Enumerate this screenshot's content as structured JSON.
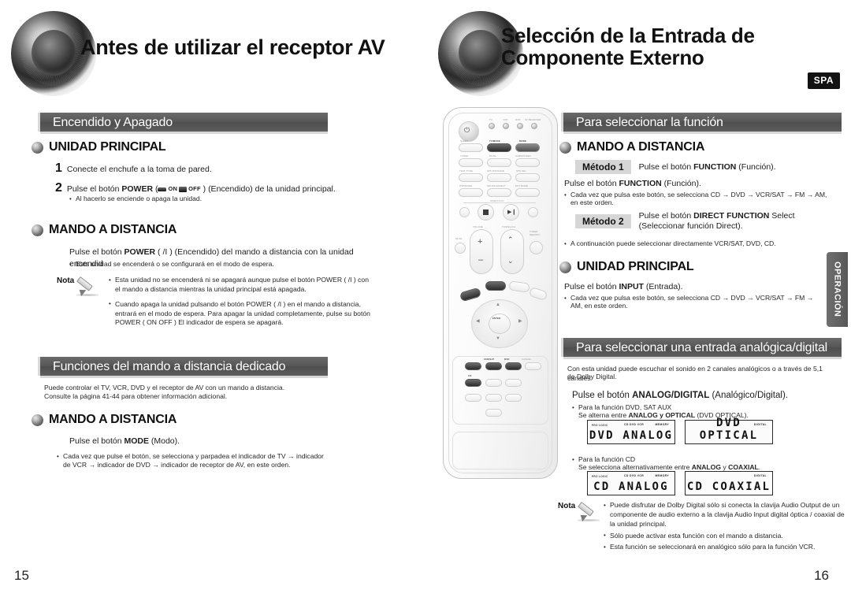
{
  "left_page": {
    "chapter_title": "Antes de utilizar el receptor AV",
    "page_number": "15",
    "sections": [
      {
        "bar_title": "Encendido y Apagado",
        "head1": "UNIDAD PRINCIPAL",
        "step1_num": "1",
        "step1_text": "Conecte el enchufe a la toma de pared.",
        "step2_num": "2",
        "step2_a": "Pulse el botón ",
        "step2_b": "POWER",
        "step2_c": " (",
        "step2_on": "ON",
        "step2_off": "OFF",
        "step2_d": " ) (Encendido) de la unidad principal.",
        "step2_note": "Al hacerlo se enciende o apaga la unidad.",
        "head2": "MANDO A DISTANCIA",
        "rc_line_a": "Pulse el botón ",
        "rc_line_b": "POWER",
        "rc_line_c": " (      /I ) (Encendido) del mando a distancia con la unidad encendid",
        "rc_note": "Esta unidad se encenderá o se configurará en el modo de espera.",
        "nota_label": "Nota",
        "nota_items": [
          "Esta unidad no se encenderá ni se apagará aunque pulse el botón POWER (   /I ) con el mando a distancia mientras la unidad principal está apagada.",
          "Cuando apaga la unidad pulsando el botón POWER (   /I ) en el mando a distancia, entrará en el modo de espera. Para apagar la unidad completamente, pulse su botón POWER (    ON    OFF  ) El indicador de espera se apagará."
        ]
      },
      {
        "bar_title": "Funciones del mando a distancia dedicado",
        "intro_l1": "Puede controlar el TV, VCR, DVD y el receptor de AV con un mando a distancia.",
        "intro_l2": "Consulte la página 41-44 para obtener información adicional.",
        "head1": "MANDO A DISTANCIA",
        "line_a": "Pulse el botón ",
        "line_b": "MODE",
        "line_c": " (Modo).",
        "note_l1": "Cada vez que pulse el botón, se selecciona y parpadea el indicador de TV  → indicador",
        "note_l2": "de VCR → indicador de DVD → indicador de receptor de AV, en este orden."
      }
    ]
  },
  "right_page": {
    "chapter_title_l1": "Selección de la Entrada de",
    "chapter_title_l2": "Componente Externo",
    "badge": "SPA",
    "side_tab": "OPERACIÓN",
    "page_number": "16",
    "sections": [
      {
        "bar_title": "Para seleccionar la función",
        "head1": "MANDO A DISTANCIA",
        "metodo1_tag": "Método 1",
        "metodo1_text_a": "Pulse el botón ",
        "metodo1_text_b": "FUNCTION",
        "metodo1_text_c": " (Función).",
        "metodo1_repeat_a": "Pulse el botón ",
        "metodo1_repeat_b": "FUNCTION",
        "metodo1_repeat_c": " (Función).",
        "metodo1_note_l1": "Cada vez que pulsa este botón, se selecciona  CD → DVD → VCR/SAT → FM → AM,",
        "metodo1_note_l2": "en este orden.",
        "metodo2_tag": "Método 2",
        "metodo2_text_a": "Pulse el botón ",
        "metodo2_text_b": "DIRECT FUNCTION",
        "metodo2_text_c": " Select",
        "metodo2_text_d": "(Seleccionar función Direct).",
        "metodo2_note": "A continuación puede seleccionar directamente VCR/SAT, DVD, CD.",
        "head2": "UNIDAD PRINCIPAL",
        "main_line_a": "Pulse el botón ",
        "main_line_b": "INPUT",
        "main_line_c": " (Entrada).",
        "main_note_l1": "Cada vez que pulsa este botón, se selecciona CD → DVD → VCR/SAT → FM →",
        "main_note_l2": "AM, en este orden."
      },
      {
        "bar_title": "Para seleccionar una entrada analógica/digital",
        "intro_l1": "Con esta unidad puede escuchar el sonido en 2 canales analógicos o a través de 5,1 canales",
        "intro_l2": "de Dolby Digital.",
        "press_a": "Pulse el botón ",
        "press_b": "ANALOG/DIGITAL",
        "press_c": " (Analógico/Digital).",
        "dvd_note_l1": "Para la función DVD, SAT AUX",
        "dvd_note_l2_a": "Se alterna entre ",
        "dvd_note_l2_b": "ANALOG y OPTICAL",
        "dvd_note_l2_c": " (DVD OPTICAL).",
        "cd_note_l1": "Para la función CD",
        "cd_note_l2_a": "Se selecciona alternativamente entre ",
        "cd_note_l2_b": "ANALOG",
        "cd_note_l2_c": " y ",
        "cd_note_l2_d": "COAXIAL",
        "cd_note_l2_e": ".",
        "displays": [
          {
            "micro_left": "PRO LOGIC",
            "micro_center": "CD DVD VCR",
            "micro_right": "MEMORY",
            "text": "DVD ANALOG"
          },
          {
            "micro_left": "",
            "micro_center": "",
            "micro_right": "DIGITAL",
            "text": "DVD OPTICAL"
          },
          {
            "micro_left": "PRO LOGIC",
            "micro_center": "CD DVD VCR",
            "micro_right": "MEMORY",
            "text": "CD ANALOG"
          },
          {
            "micro_left": "",
            "micro_center": "",
            "micro_right": "DIGITAL",
            "text": "CD COAXIAL"
          }
        ],
        "nota_label": "Nota",
        "nota_items": [
          "Puede disfrutar de Dolby Digital sólo si conecta la clavija Audio Output de un componente de audio externo a la clavija Audio Input digital óptica / coaxial de la unidad principal.",
          "Sólo puede activar esta función con el mando a distancia.",
          "Esta función se seleccionará en analógico sólo para la función VCR."
        ]
      }
    ]
  },
  "remote": {
    "labels": {
      "power": "",
      "led_tv": "TV",
      "led_vcr": "VCR",
      "led_dvd": "DVD",
      "led_avr": "AV RECEIVER",
      "sleep": "SLEEP",
      "tv_mode": "TV/MODE",
      "mode": "MODE",
      "tuner": "TUNER",
      "mute": "MUTE",
      "subwoofer": "SUBWOOFER",
      "test_tone": "TEST TONE",
      "spk_distance": "SPK DISTANCE",
      "spk_sel": "SPK SEL",
      "dsp_mode": "DSP/MODE",
      "sound_effect": "SOUND EFFECT",
      "ppv_mode": "PPV MODE",
      "operation": "OPERATION",
      "volume": "VOLUME",
      "tuning_ch": "TUNING/CH",
      "tuner_memory": "TUNER MEMORY",
      "enter": "ENTER",
      "vcr_sat": "VCR/SAT",
      "dvd": "DVD",
      "cd": "CD",
      "cancel": "CANCEL"
    }
  }
}
